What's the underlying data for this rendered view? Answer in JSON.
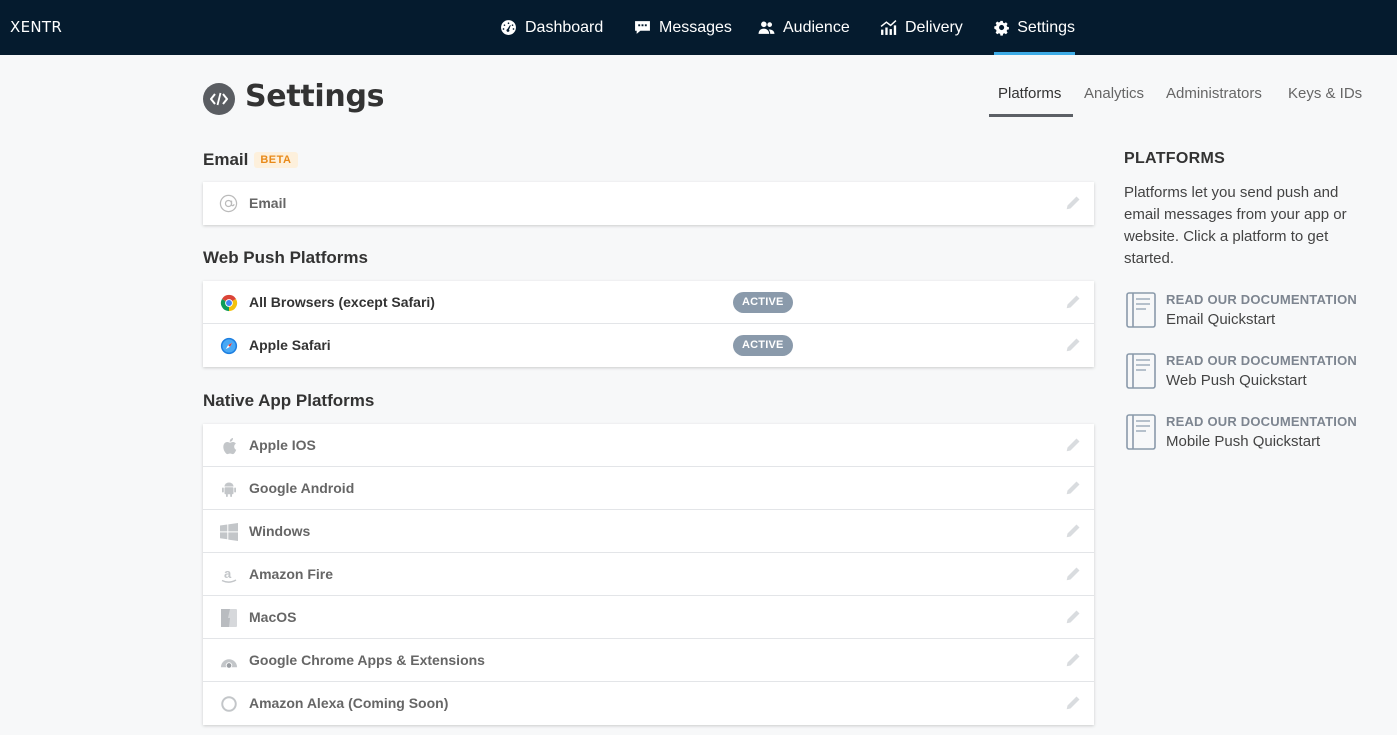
{
  "app": {
    "brand": "XENTR"
  },
  "nav": {
    "items": [
      {
        "label": "Dashboard",
        "icon": "dashboard-icon"
      },
      {
        "label": "Messages",
        "icon": "messages-icon"
      },
      {
        "label": "Audience",
        "icon": "audience-icon"
      },
      {
        "label": "Delivery",
        "icon": "delivery-icon"
      },
      {
        "label": "Settings",
        "icon": "gear-icon",
        "active": true
      }
    ]
  },
  "page": {
    "title": "Settings",
    "icon": "code-icon"
  },
  "subtabs": [
    {
      "label": "Platforms",
      "active": true
    },
    {
      "label": "Analytics"
    },
    {
      "label": "Administrators"
    },
    {
      "label": "Keys & IDs"
    }
  ],
  "email_section": {
    "title": "Email",
    "badge": "BETA",
    "rows": [
      {
        "label": "Email",
        "icon": "at-icon"
      }
    ]
  },
  "web_push_section": {
    "title": "Web Push Platforms",
    "rows": [
      {
        "label": "All Browsers (except Safari)",
        "icon": "chrome-icon",
        "status": "ACTIVE"
      },
      {
        "label": "Apple Safari",
        "icon": "safari-icon",
        "status": "ACTIVE"
      }
    ]
  },
  "native_section": {
    "title": "Native App Platforms",
    "rows": [
      {
        "label": "Apple IOS",
        "icon": "apple-icon"
      },
      {
        "label": "Google Android",
        "icon": "android-icon"
      },
      {
        "label": "Windows",
        "icon": "windows-icon"
      },
      {
        "label": "Amazon Fire",
        "icon": "amazon-icon"
      },
      {
        "label": "MacOS",
        "icon": "finder-icon"
      },
      {
        "label": "Google Chrome Apps & Extensions",
        "icon": "chrome-apps-icon"
      },
      {
        "label": "Amazon Alexa (Coming Soon)",
        "icon": "alexa-icon"
      }
    ]
  },
  "sidebar": {
    "title": "PLATFORMS",
    "text": "Platforms let you send push and email messages from your app or website. Click a platform to get started.",
    "docs": [
      {
        "kicker": "READ OUR DOCUMENTATION",
        "label": "Email Quickstart",
        "icon": "document-icon"
      },
      {
        "kicker": "READ OUR DOCUMENTATION",
        "label": "Web Push Quickstart",
        "icon": "document-icon"
      },
      {
        "kicker": "READ OUR DOCUMENTATION",
        "label": "Mobile Push Quickstart",
        "icon": "document-icon"
      }
    ]
  },
  "colors": {
    "nav_bg": "#051b2e",
    "nav_active_underline": "#3dabe6",
    "badge_bg": "#8a9aab",
    "beta_bg": "#fdf0dc",
    "beta_text": "#e88a1a"
  }
}
